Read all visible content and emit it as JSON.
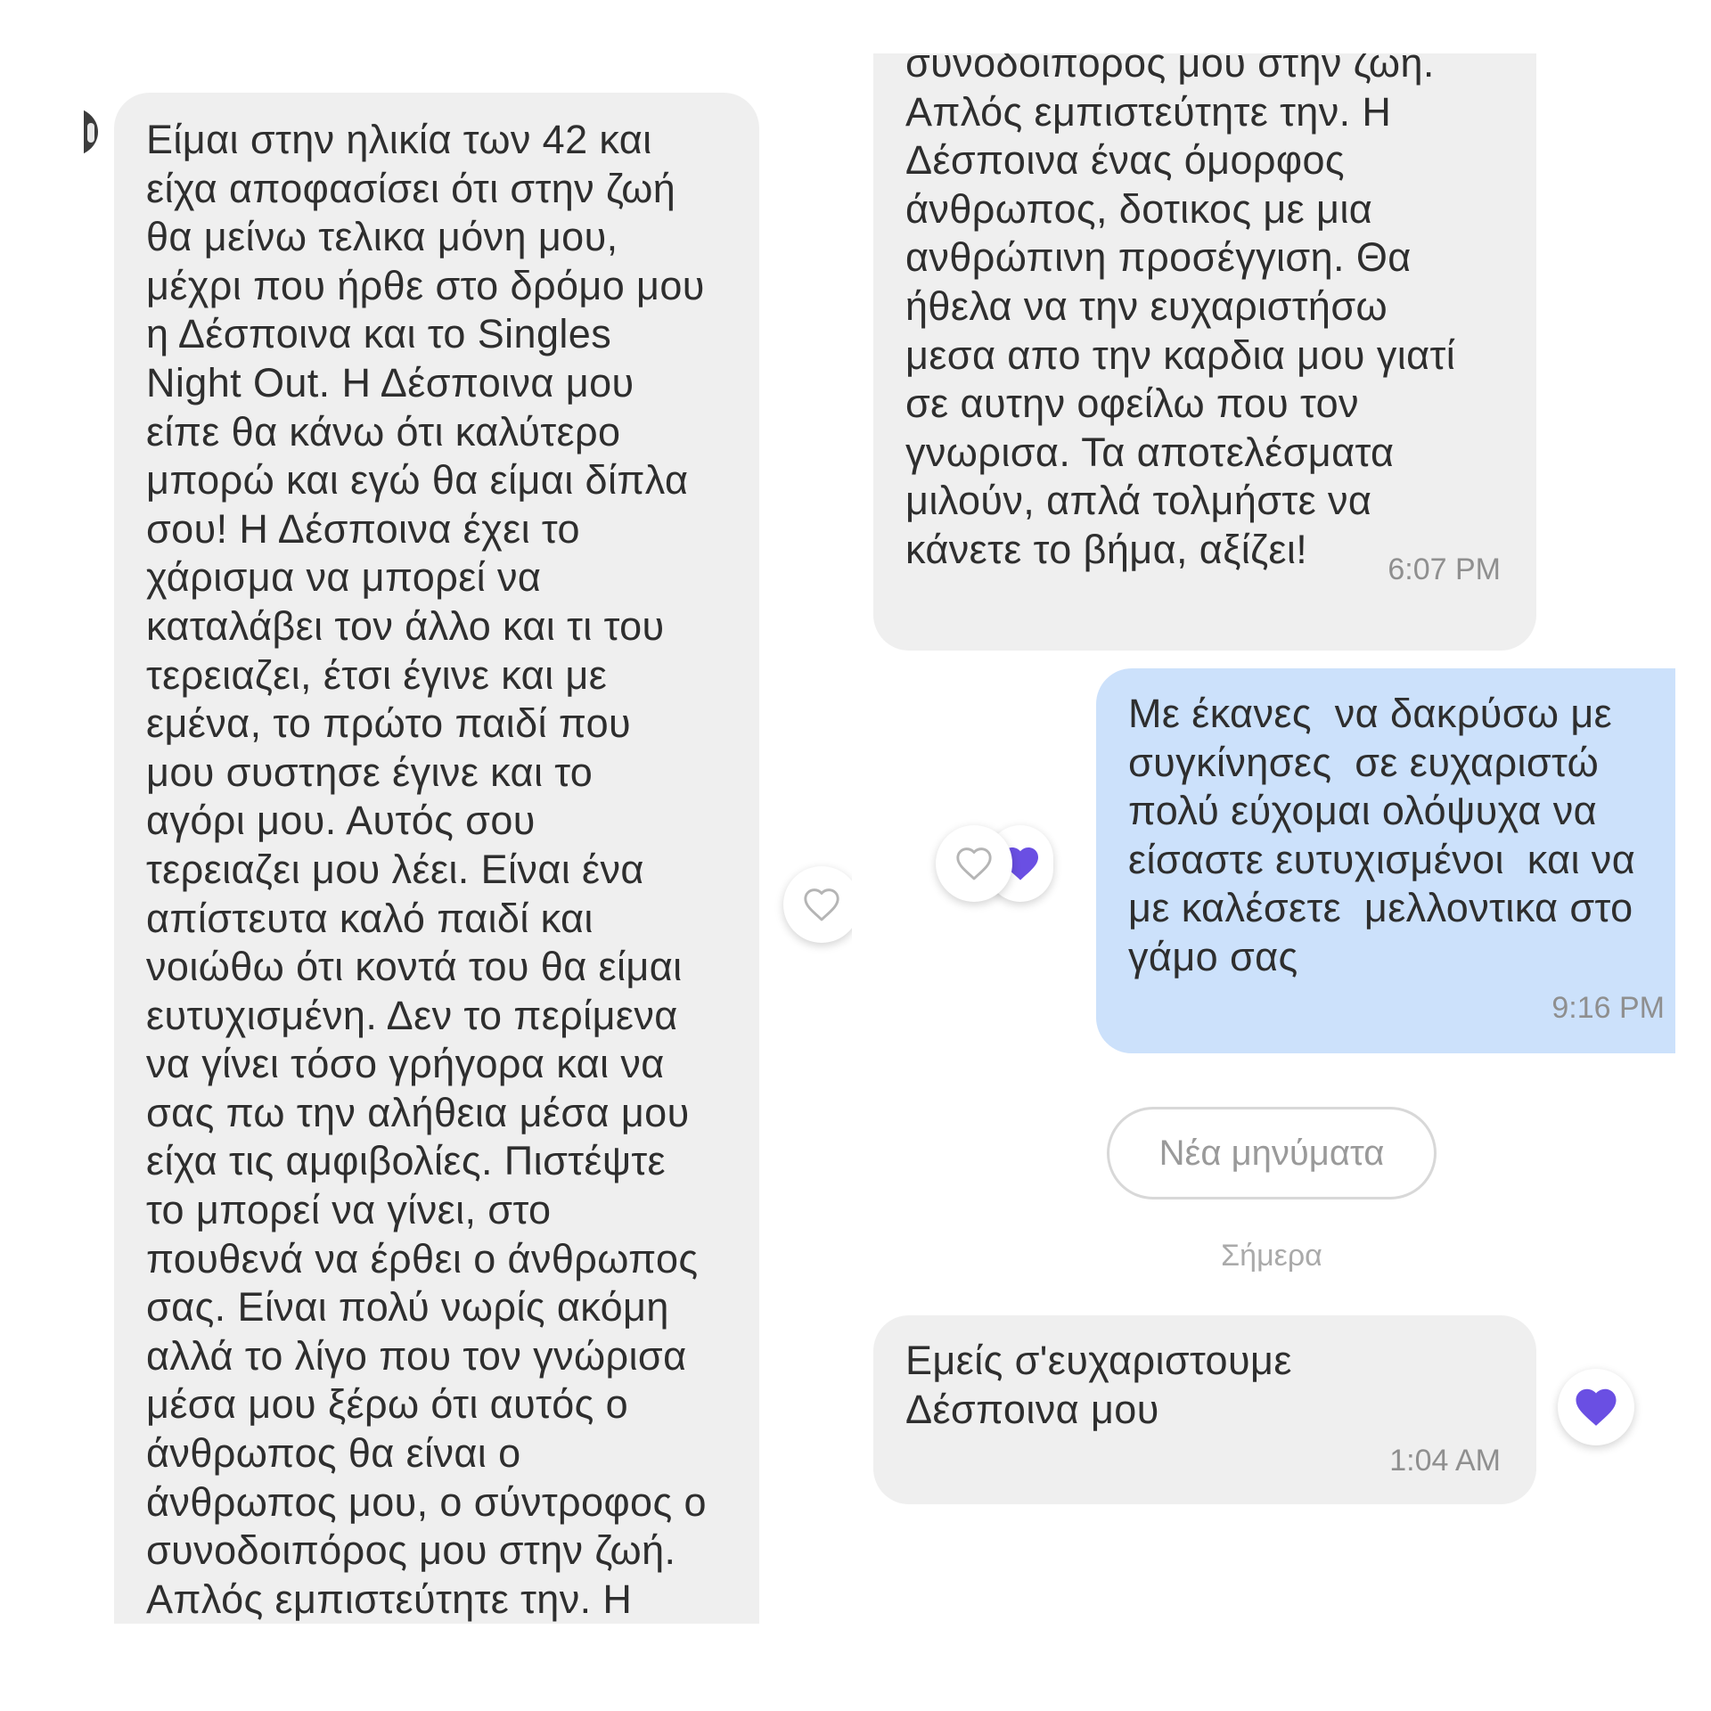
{
  "colors": {
    "incoming_bubble": "#efefef",
    "outgoing_bubble": "#cce1fb",
    "heart_filled": "#6a4fe3",
    "heart_outline": "#b5b5b5",
    "timestamp": "#8f8f8f"
  },
  "left_message": {
    "text": "Είμαι στην ηλικία των 42 και\nείχα αποφασίσει ότι στην ζωή\nθα μείνω τελικα μόνη μου,\nμέχρι που ήρθε στο δρόμο μου\nη Δέσποινα και το Singles\nNight Out.  Η Δέσποινα μου\nείπε θα κάνω ότι καλύτερο\nμπορώ και εγώ θα είμαι δίπλα\nσου!  Η Δέσποινα έχει το\nχάρισμα να μπορεί να\nκαταλάβει τον άλλο και τι του\nτερειαζει, έτσι έγινε και με\nεμένα, το πρώτο παιδί που\nμου συστησε έγινε και το\nαγόρι μου. Αυτός σου\nτερειαζει μου λέει. Είναι ένα\nαπίστευτα καλό παιδί και\nνοιώθω ότι κοντά του θα είμαι\nευτυχισμένη. Δεν το περίμενα\nνα γίνει τόσο γρήγορα και να\nσας πω την αλήθεια μέσα μου\nείχα τις αμφιβολίες. Πιστέψτε\nτο μπορεί να γίνει, στο\nπουθενά να έρθει ο άνθρωπος\nσας. Είναι πολύ νωρίς ακόμη\nαλλά το λίγο που τον γνώρισα\nμέσα μου ξέρω ότι αυτός ο\nάνθρωπος θα είναι ο\nάνθρωπος μου, ο σύντροφος ο\nσυνοδοιπόρος μου στην ζωή.\nΑπλός εμπιστεύτητε την. Η",
    "reaction_icon": "heart-outline-icon"
  },
  "right_messages": [
    {
      "text": "συνοδοιπορος μου στην ζωη.\nΑπλός εμπιστεύτητε την. Η\nΔέσποινα ένας όμορφος\nάνθρωπος, δοτικος με μια\nανθρώπινη προσέγγιση. Θα\nήθελα να την ευχαριστήσω\nμεσα απο την καρδια μου γιατί\nσε αυτην οφείλω που τον\nγνωρισα. Τα αποτελέσματα\nμιλούν, απλά τολμήστε να\nκάνετε το βήμα, αξίζει!",
      "time": "6:07 PM"
    },
    {
      "text": "Με έκανες  να δακρύσω με\nσυγκίνησες  σε ευχαριστώ\nπολύ εύχομαι ολόψυχα να\nείσαστε ευτυχισμένοι  και να\nμε καλέσετε  μελλοντικα στο\nγάμο σας",
      "time": "9:16 PM",
      "reactions": [
        "heart-outline-icon",
        "heart-filled-icon"
      ]
    },
    {
      "text": "Εμείς σ'ευχαριστουμε\nΔέσποινα μου",
      "time": "1:04 AM",
      "reaction_icon": "heart-filled-icon"
    }
  ],
  "new_messages_label": "Νέα μηνύματα",
  "date_separator": "Σήμερα"
}
